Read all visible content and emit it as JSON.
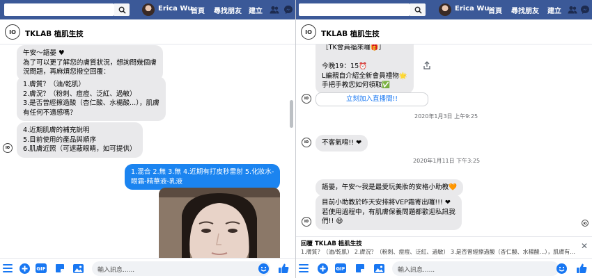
{
  "nav": {
    "user_name": "Erica Wu",
    "home_label": "首頁",
    "find_friends_label": "尋找朋友",
    "create_label": "建立"
  },
  "chat": {
    "title": "TKLAB 植肌生技",
    "logo_text": "IO",
    "logo_sub": "TKLAB"
  },
  "left_messages": [
    {
      "text": "午安～語晏 ♥\n為了可以更了解您的膚質狀況，想詢問幾個膚\n況問題，再麻煩您撥空回覆："
    },
    {
      "text": "1.膚質？（油/乾肌）\n2.膚況？（粉刺、痘痘、泛紅、過敏）\n3.是否曾經擦過酸（杏仁酸、水楊酸...），肌膚\n有任何不適感嗎？"
    },
    {
      "text": "4.近期肌膚的補充說明\n5.目前使用的產品與順序\n6.肌膚近照（可遮蔽眼睛，如可提供）"
    },
    {
      "text": "1.混合 2.無 3.無 4.近期有打皮秒雷射 5.化妝水-\n眼霜-精華液-乳液"
    }
  ],
  "right_messages": [
    {
      "text": "［TK會員福來囉🎁］\n\n今晚19：15⏰\nL編親自介紹全新會員禮物🌟\n手把手教您如何領取✅"
    },
    {
      "text": "立刻加入直播間!!"
    },
    {
      "text": "2020年1月3日 上午9:25"
    },
    {
      "text": "不客氣唷!! ❤"
    },
    {
      "text": "2020年1月11日 下午3:25"
    },
    {
      "text": "語晏，午安～我是最愛玩美妝的安格小助教🧡"
    },
    {
      "text": "目前小助教於昨天安排將VEP霜寄出囉!!! ❤\n若使用過程中，有肌膚保養問題都歡迎私訊我\n們!! 😄"
    }
  ],
  "preview": {
    "title": "回覆 TKLAB 植肌生技",
    "text": "1.膚質？（油/乾肌） 2.膚況？（粉刺、痘痘、泛紅、過敏） 3.是否曾經擦過酸（杏仁酸、水楊酸...），肌膚有..."
  },
  "composer": {
    "placeholder": "輸入訊息......",
    "gif_label": "GIF"
  },
  "colors": {
    "fb_blue": "#3b5998",
    "messenger_blue": "#1877f2",
    "bubble_gray": "#e9e9eb"
  }
}
